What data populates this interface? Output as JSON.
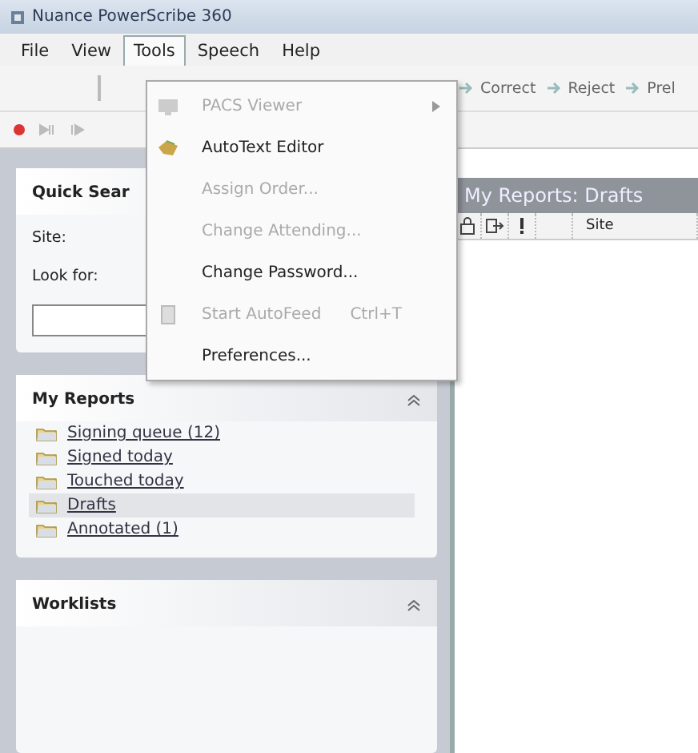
{
  "window": {
    "title": "Nuance PowerScribe 360"
  },
  "menu_bar": [
    {
      "label": "File",
      "selected": false
    },
    {
      "label": "View",
      "selected": false
    },
    {
      "label": "Tools",
      "selected": true
    },
    {
      "label": "Speech",
      "selected": false
    },
    {
      "label": "Help",
      "selected": false
    }
  ],
  "toolbar": [
    {
      "label": "Correct"
    },
    {
      "label": "Reject"
    },
    {
      "label": "Prel"
    }
  ],
  "dropdown": {
    "items": [
      {
        "label": "PACS Viewer",
        "disabled": true,
        "has_submenu": true,
        "kind": "viewer"
      },
      {
        "label": "AutoText Editor",
        "disabled": false,
        "kind": "hand"
      },
      {
        "label": "Assign Order...",
        "disabled": true,
        "kind": "plain"
      },
      {
        "label": "Change Attending...",
        "disabled": true,
        "kind": "plain"
      },
      {
        "label": "Change Password...",
        "disabled": false,
        "kind": "plain"
      },
      {
        "label": "Start AutoFeed",
        "shortcut": "Ctrl+T",
        "disabled": true,
        "kind": "feed"
      },
      {
        "label": "Preferences...",
        "disabled": false,
        "kind": "plain"
      }
    ]
  },
  "quick_search": {
    "title": "Quick Sear",
    "fields": [
      {
        "label": "Site:"
      },
      {
        "label": "Look for:"
      }
    ]
  },
  "my_reports": {
    "title": "My Reports",
    "items": [
      {
        "label": "Signing queue (12)",
        "selected": false
      },
      {
        "label": "Signed today",
        "selected": false
      },
      {
        "label": "Touched today",
        "selected": false
      },
      {
        "label": "Drafts",
        "selected": true
      },
      {
        "label": "Annotated (1)",
        "selected": false
      }
    ]
  },
  "worklists": {
    "title": "Worklists"
  },
  "reports_view": {
    "title": "My Reports: Drafts",
    "columns": [
      {
        "kind": "lock"
      },
      {
        "kind": "export"
      },
      {
        "kind": "priority"
      },
      {
        "kind": "blank"
      },
      {
        "kind": "text",
        "label": "Site"
      }
    ]
  }
}
